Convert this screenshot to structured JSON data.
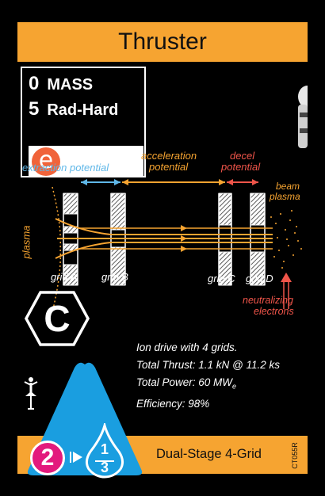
{
  "card": {
    "title": "Thruster",
    "mass_value": "0",
    "mass_label": "MASS",
    "radhard_value": "5",
    "radhard_label": "Rad-Hard",
    "type_letter": "e",
    "class_letter": "C",
    "diagram": {
      "extraction_label": "extraction potential",
      "acceleration_label_1": "acceleration",
      "acceleration_label_2": "potential",
      "decel_label_1": "decel",
      "decel_label_2": "potential",
      "beam_label_1": "beam",
      "beam_label_2": "plasma",
      "plasma_label": "plasma",
      "grid_a": "grid A",
      "grid_b": "grid B",
      "grid_c": "grid C",
      "grid_d": "grid D",
      "neutralizing_1": "neutralizing",
      "neutralizing_2": "electrons"
    },
    "description": {
      "line1": "Ion drive with 4 grids.",
      "line2": "Total Thrust: 1.1 kN @ 11.2 ks",
      "line3_prefix": "Total Power: 60 MW",
      "line3_sub": "e",
      "line4": "Efficiency: 98%"
    },
    "fuel_value": "2",
    "fraction_num": "1",
    "fraction_den": "3",
    "name": "Dual-Stage 4-Grid",
    "card_code": "CT055R",
    "colors": {
      "orange": "#f6a431",
      "blue_triangle": "#1a9ee0",
      "magenta": "#e3197d",
      "extraction_blue": "#5fb7e8",
      "decel_red": "#f0554a"
    }
  }
}
